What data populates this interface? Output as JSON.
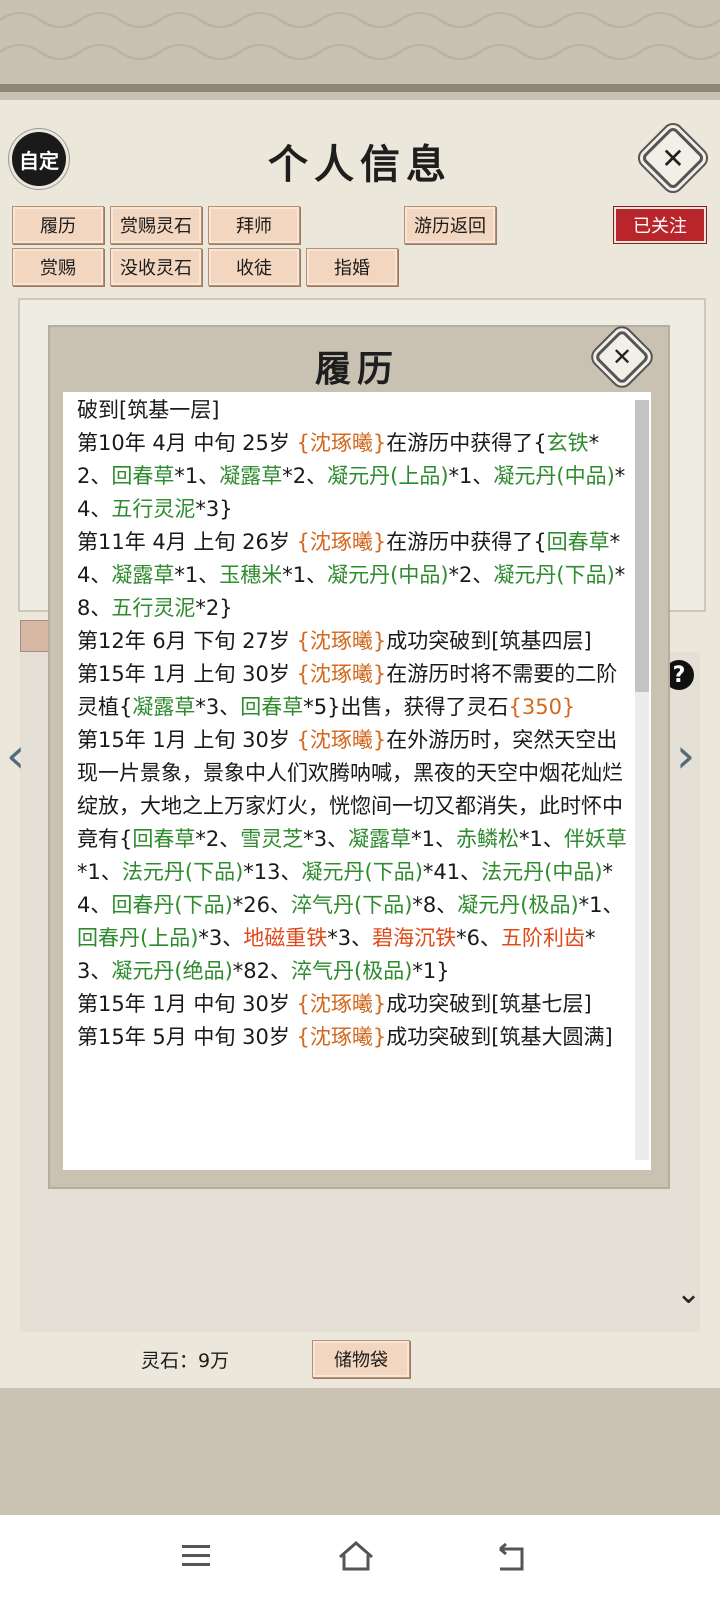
{
  "header": {
    "custom_label": "自定",
    "title": "个人信息",
    "close_glyph": "✕",
    "followed_label": "已关注"
  },
  "tabs": {
    "row1": [
      "履历",
      "赏赐灵石",
      "拜师",
      "游历返回"
    ],
    "row2": [
      "赏赐",
      "没收灵石",
      "收徒",
      "指婚"
    ]
  },
  "modal": {
    "title": "履历",
    "close_glyph": "✕",
    "log": [
      [
        {
          "t": "破到[筑基一层]",
          "c": "n"
        }
      ],
      [
        {
          "t": "第10年 4月 中旬 25岁 ",
          "c": "n"
        },
        {
          "t": "{沈琢曦}",
          "c": "o"
        },
        {
          "t": "在游历中获得了{",
          "c": "n"
        },
        {
          "t": "玄铁",
          "c": "g"
        },
        {
          "t": "*2、",
          "c": "n"
        },
        {
          "t": "回春草",
          "c": "g"
        },
        {
          "t": "*1、",
          "c": "n"
        },
        {
          "t": "凝露草",
          "c": "g"
        },
        {
          "t": "*2、",
          "c": "n"
        },
        {
          "t": "凝元丹(上品)",
          "c": "g"
        },
        {
          "t": "*1、",
          "c": "n"
        },
        {
          "t": "凝元丹(中品)",
          "c": "g"
        },
        {
          "t": "*4、",
          "c": "n"
        },
        {
          "t": "五行灵泥",
          "c": "g"
        },
        {
          "t": "*3}",
          "c": "n"
        }
      ],
      [
        {
          "t": "第11年 4月 上旬 26岁 ",
          "c": "n"
        },
        {
          "t": "{沈琢曦}",
          "c": "o"
        },
        {
          "t": "在游历中获得了{",
          "c": "n"
        },
        {
          "t": "回春草",
          "c": "g"
        },
        {
          "t": "*4、",
          "c": "n"
        },
        {
          "t": "凝露草",
          "c": "g"
        },
        {
          "t": "*1、",
          "c": "n"
        },
        {
          "t": "玉穗米",
          "c": "g"
        },
        {
          "t": "*1、",
          "c": "n"
        },
        {
          "t": "凝元丹(中品)",
          "c": "g"
        },
        {
          "t": "*2、",
          "c": "n"
        },
        {
          "t": "凝元丹(下品)",
          "c": "g"
        },
        {
          "t": "*8、",
          "c": "n"
        },
        {
          "t": "五行灵泥",
          "c": "g"
        },
        {
          "t": "*2}",
          "c": "n"
        }
      ],
      [
        {
          "t": "第12年 6月 下旬 27岁 ",
          "c": "n"
        },
        {
          "t": "{沈琢曦}",
          "c": "o"
        },
        {
          "t": "成功突破到[筑基四层]",
          "c": "n"
        }
      ],
      [
        {
          "t": "第15年 1月 上旬 30岁 ",
          "c": "n"
        },
        {
          "t": "{沈琢曦}",
          "c": "o"
        },
        {
          "t": "在游历时将不需要的二阶灵植{",
          "c": "n"
        },
        {
          "t": "凝露草",
          "c": "g"
        },
        {
          "t": "*3、",
          "c": "n"
        },
        {
          "t": "回春草",
          "c": "g"
        },
        {
          "t": "*5}出售，获得了灵石",
          "c": "n"
        },
        {
          "t": "{350}",
          "c": "o"
        }
      ],
      [
        {
          "t": "第15年 1月 上旬 30岁 ",
          "c": "n"
        },
        {
          "t": "{沈琢曦}",
          "c": "o"
        },
        {
          "t": "在外游历时，突然天空出现一片景象，景象中人们欢腾呐喊，黑夜的天空中烟花灿烂绽放，大地之上万家灯火，恍惚间一切又都消失，此时怀中竟有{",
          "c": "n"
        },
        {
          "t": "回春草",
          "c": "g"
        },
        {
          "t": "*2、",
          "c": "n"
        },
        {
          "t": "雪灵芝",
          "c": "g"
        },
        {
          "t": "*3、",
          "c": "n"
        },
        {
          "t": "凝露草",
          "c": "g"
        },
        {
          "t": "*1、",
          "c": "n"
        },
        {
          "t": "赤鳞松",
          "c": "g"
        },
        {
          "t": "*1、",
          "c": "n"
        },
        {
          "t": "伴妖草",
          "c": "g"
        },
        {
          "t": "*1、",
          "c": "n"
        },
        {
          "t": "法元丹(下品)",
          "c": "g"
        },
        {
          "t": "*13、",
          "c": "n"
        },
        {
          "t": "凝元丹(下品)",
          "c": "g"
        },
        {
          "t": "*41、",
          "c": "n"
        },
        {
          "t": "法元丹(中品)",
          "c": "g"
        },
        {
          "t": "*4、",
          "c": "n"
        },
        {
          "t": "回春丹(下品)",
          "c": "g"
        },
        {
          "t": "*26、",
          "c": "n"
        },
        {
          "t": "淬气丹(下品)",
          "c": "g"
        },
        {
          "t": "*8、",
          "c": "n"
        },
        {
          "t": "凝元丹(极品)",
          "c": "g"
        },
        {
          "t": "*1、",
          "c": "n"
        },
        {
          "t": "回春丹(上品)",
          "c": "g"
        },
        {
          "t": "*3、",
          "c": "n"
        },
        {
          "t": "地磁重铁",
          "c": "r"
        },
        {
          "t": "*3、",
          "c": "n"
        },
        {
          "t": "碧海沉铁",
          "c": "r"
        },
        {
          "t": "*6、",
          "c": "n"
        },
        {
          "t": "五阶利齿",
          "c": "r"
        },
        {
          "t": "*3、",
          "c": "n"
        },
        {
          "t": "凝元丹(绝品)",
          "c": "g"
        },
        {
          "t": "*82、",
          "c": "n"
        },
        {
          "t": "淬气丹(极品)",
          "c": "g"
        },
        {
          "t": "*1}",
          "c": "n"
        }
      ],
      [
        {
          "t": "第15年 1月 中旬 30岁 ",
          "c": "n"
        },
        {
          "t": "{沈琢曦}",
          "c": "o"
        },
        {
          "t": "成功突破到[筑基七层]",
          "c": "n"
        }
      ],
      [
        {
          "t": "第15年 5月 中旬 30岁 ",
          "c": "n"
        },
        {
          "t": "{沈琢曦}",
          "c": "o"
        },
        {
          "t": "成功突破到[筑基大圆满]",
          "c": "n"
        }
      ]
    ]
  },
  "footer": {
    "spirit_stone": "灵石：9万",
    "bag_label": "储物袋"
  },
  "nav": {
    "left_arrow": "‹",
    "right_arrow": "›",
    "help": "?",
    "more": "⌄"
  },
  "colors": {
    "item_green": "#2e8b2e",
    "name_orange": "#d2691e",
    "rare_red": "#e04a1a",
    "followed_red": "#b8262c"
  },
  "icons": {
    "menu": "menu-icon",
    "home": "home-icon",
    "back": "back-icon"
  }
}
